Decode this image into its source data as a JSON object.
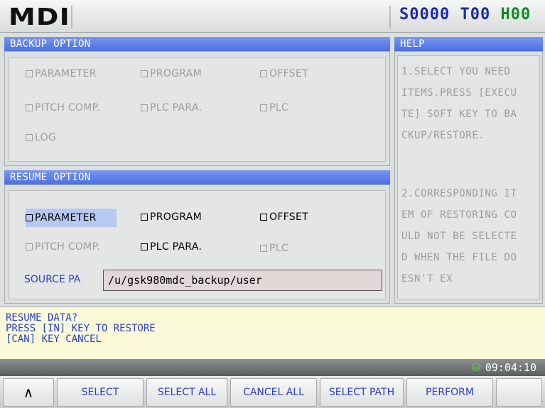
{
  "header": {
    "mode": "MDI",
    "s_value": "S0000",
    "t_value": "T00",
    "h_value": "H00"
  },
  "backup": {
    "title": "BACKUP OPTION",
    "items": [
      "PARAMETER",
      "PROGRAM",
      "OFFSET",
      "PITCH COMP.",
      "PLC PARA.",
      "PLC",
      "LOG"
    ]
  },
  "resume": {
    "title": "RESUME OPTION",
    "items": [
      "PARAMETER",
      "PROGRAM",
      "OFFSET",
      "PITCH COMP.",
      "PLC PARA.",
      "PLC"
    ],
    "source_label": "SOURCE PA",
    "source_value": "/u/gsk980mdc_backup/user"
  },
  "help": {
    "title": "HELP",
    "text1": "1.SELECT YOU NEED\nITEMS.PRESS [EXECU\nTE] SOFT KEY TO BA\nCKUP/RESTORE.",
    "text2": "2.CORRESPONDING IT\nEM OF RESTORING CO\nULD NOT BE SELECTE\nD WHEN THE FILE DO\nESN'T EX"
  },
  "message": {
    "line1": "RESUME DATA?",
    "line2": "PRESS [IN] KEY TO RESTORE",
    "line3": "[CAN] KEY CANCEL"
  },
  "clock": "09:04:10",
  "softkeys": {
    "up": "∧",
    "select": "SELECT",
    "select_all": "SELECT ALL",
    "cancel_all": "CANCEL ALL",
    "select_path": "SELECT PATH",
    "perform": "PERFORM"
  }
}
